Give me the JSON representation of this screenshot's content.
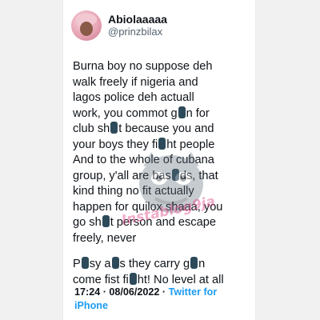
{
  "tweet": {
    "display_name": "Abiolaaaaa",
    "handle": "@prinzbilax",
    "lines": [
      "Burna boy no suppose deh",
      "walk freely if nigeria and",
      "lagos police deh actuall",
      "work, you commot g",
      "n for",
      "club sh",
      "t because you and",
      "your boys they fi",
      "ht people",
      "And to the whole of cubana",
      "group, y'all are bas",
      "ds, that",
      "kind thing no fit actually",
      "happen for quilox shaaa, you",
      "go sh",
      "t person and escape",
      "freely, never",
      "P",
      "sy a",
      "s they carry g",
      "n",
      "come fist fi",
      "ht! No level at all"
    ],
    "timestamp": "17:24 · 08/06/2022 ·",
    "source": "Twitter for iPhone",
    "watermark": "Instablog9ja"
  },
  "colors": {
    "background": "#f1f1f1",
    "card": "#ffffff",
    "text": "#0f1419",
    "secondary": "#536471",
    "link": "#1d9bf0",
    "watermark": "#e04a8a"
  }
}
